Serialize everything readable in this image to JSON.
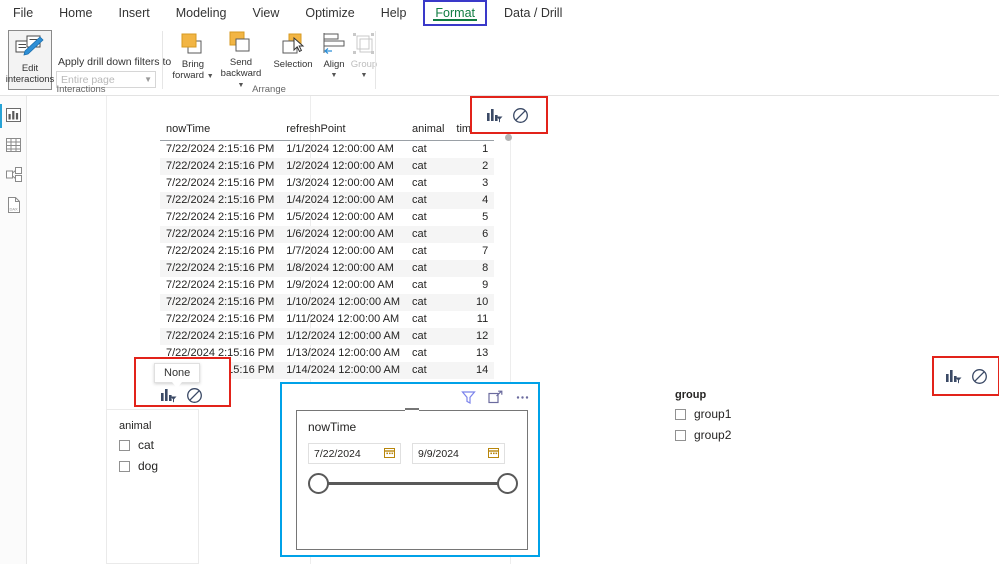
{
  "ribbon": {
    "tabs": [
      {
        "label": "File",
        "selected": false
      },
      {
        "label": "Home",
        "selected": false
      },
      {
        "label": "Insert",
        "selected": false
      },
      {
        "label": "Modeling",
        "selected": false
      },
      {
        "label": "View",
        "selected": false
      },
      {
        "label": "Optimize",
        "selected": false
      },
      {
        "label": "Help",
        "selected": false
      },
      {
        "label": "Format",
        "selected": true
      },
      {
        "label": "Data / Drill",
        "selected": false
      }
    ],
    "accent_green": "#107c41",
    "highlight_box": "#3a39c9",
    "groups": {
      "interactions": {
        "label": "Interactions",
        "edit_interactions_line1": "Edit",
        "edit_interactions_line2": "interactions",
        "filters_label": "Apply drill down filters to",
        "filters_placeholder": "Entire page",
        "filters_value": ""
      },
      "arrange": {
        "label": "Arrange",
        "bring_forward_line1": "Bring",
        "bring_forward_line2": "forward",
        "send_backward_line1": "Send",
        "send_backward_line2": "backward",
        "selection": "Selection",
        "align": "Align",
        "group": "Group"
      }
    }
  },
  "rail": {
    "items": [
      {
        "name": "report-view",
        "active": true
      },
      {
        "name": "table-view",
        "active": false
      },
      {
        "name": "model-view",
        "active": false
      },
      {
        "name": "dax-query-view",
        "active": false
      }
    ]
  },
  "table_visual": {
    "columns": [
      "nowTime",
      "refreshPoint",
      "animal",
      "timeID"
    ],
    "rows": [
      [
        "7/22/2024 2:15:16 PM",
        "1/1/2024 12:00:00 AM",
        "cat",
        "1"
      ],
      [
        "7/22/2024 2:15:16 PM",
        "1/2/2024 12:00:00 AM",
        "cat",
        "2"
      ],
      [
        "7/22/2024 2:15:16 PM",
        "1/3/2024 12:00:00 AM",
        "cat",
        "3"
      ],
      [
        "7/22/2024 2:15:16 PM",
        "1/4/2024 12:00:00 AM",
        "cat",
        "4"
      ],
      [
        "7/22/2024 2:15:16 PM",
        "1/5/2024 12:00:00 AM",
        "cat",
        "5"
      ],
      [
        "7/22/2024 2:15:16 PM",
        "1/6/2024 12:00:00 AM",
        "cat",
        "6"
      ],
      [
        "7/22/2024 2:15:16 PM",
        "1/7/2024 12:00:00 AM",
        "cat",
        "7"
      ],
      [
        "7/22/2024 2:15:16 PM",
        "1/8/2024 12:00:00 AM",
        "cat",
        "8"
      ],
      [
        "7/22/2024 2:15:16 PM",
        "1/9/2024 12:00:00 AM",
        "cat",
        "9"
      ],
      [
        "7/22/2024 2:15:16 PM",
        "1/10/2024 12:00:00 AM",
        "cat",
        "10"
      ],
      [
        "7/22/2024 2:15:16 PM",
        "1/11/2024 12:00:00 AM",
        "cat",
        "11"
      ],
      [
        "7/22/2024 2:15:16 PM",
        "1/12/2024 12:00:00 AM",
        "cat",
        "12"
      ],
      [
        "7/22/2024 2:15:16 PM",
        "1/13/2024 12:00:00 AM",
        "cat",
        "13"
      ],
      [
        "7/22/2024 2:15:16 PM",
        "1/14/2024 12:00:00 AM",
        "cat",
        "14"
      ]
    ]
  },
  "interaction_controls": {
    "highlight_color": "#e2231a",
    "tooltip_none": "None",
    "icons": [
      "filter-chart-icon",
      "none-icon"
    ]
  },
  "animal_slicer": {
    "title": "animal",
    "items": [
      {
        "label": "cat",
        "checked": false
      },
      {
        "label": "dog",
        "checked": false
      }
    ]
  },
  "group_slicer": {
    "title": "group",
    "items": [
      {
        "label": "group1",
        "checked": false
      },
      {
        "label": "group2",
        "checked": false
      }
    ]
  },
  "date_slicer": {
    "title": "nowTime",
    "start_date": "7/22/2024",
    "end_date": "9/9/2024",
    "selection_color": "#00a2e8",
    "header_icons": [
      "filter-icon",
      "focus-mode-icon",
      "more-options-icon"
    ]
  }
}
